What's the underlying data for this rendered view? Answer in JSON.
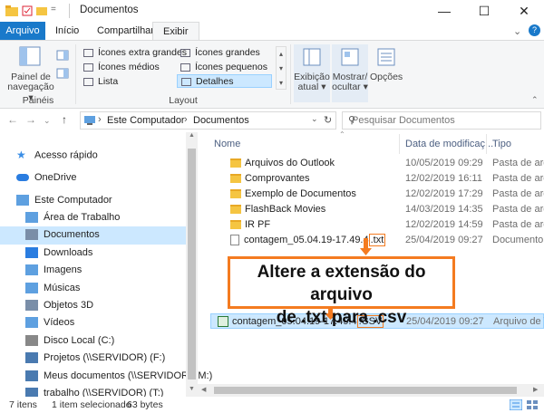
{
  "window": {
    "title": "Documentos",
    "minimize": "—",
    "maximize": "☐",
    "close": "✕",
    "qa_sep": "="
  },
  "tabs": [
    "Arquivo",
    "Início",
    "Compartilhar",
    "Exibir"
  ],
  "ribbon": {
    "panes": {
      "label_line1": "Painel de",
      "label_line2": "navegação ▾",
      "group": "Painéis"
    },
    "layout": {
      "items_col1": [
        "Ícones extra grandes",
        "Ícones médios",
        "Lista"
      ],
      "items_col2": [
        "Ícones grandes",
        "Ícones pequenos",
        "Detalhes"
      ],
      "group": "Layout"
    },
    "current_view": {
      "line1": "Exibição",
      "line2": "atual ▾"
    },
    "show_hide": {
      "line1": "Mostrar/",
      "line2": "ocultar ▾"
    },
    "options": "Opções"
  },
  "address": {
    "path1": "Este Computador",
    "path2": "Documentos",
    "search_placeholder": "Pesquisar Documentos"
  },
  "nav": {
    "items": [
      {
        "label": "Acesso rápido",
        "icon": "star-icon"
      },
      {
        "label": "OneDrive",
        "icon": "cloud-icon"
      },
      {
        "label": "Este Computador",
        "icon": "computer-icon"
      },
      {
        "label": "Área de Trabalho",
        "icon": "desktop-icon"
      },
      {
        "label": "Documentos",
        "icon": "documents-icon"
      },
      {
        "label": "Downloads",
        "icon": "download-icon"
      },
      {
        "label": "Imagens",
        "icon": "images-icon"
      },
      {
        "label": "Músicas",
        "icon": "music-icon"
      },
      {
        "label": "Objetos 3D",
        "icon": "cube-icon"
      },
      {
        "label": "Vídeos",
        "icon": "video-icon"
      },
      {
        "label": "Disco Local (C:)",
        "icon": "drive-icon"
      },
      {
        "label": "Projetos (\\\\SERVIDOR) (F:)",
        "icon": "network-drive-icon"
      },
      {
        "label": "Meus documentos (\\\\SERVIDOR) (M:)",
        "icon": "network-drive-icon"
      },
      {
        "label": "trabalho (\\\\SERVIDOR) (T:)",
        "icon": "network-drive-icon"
      }
    ]
  },
  "columns": {
    "name": "Nome",
    "date": "Data de modificaç...",
    "type": "Tipo"
  },
  "files": [
    {
      "name": "Arquivos do Outlook",
      "date": "10/05/2019 09:29",
      "type": "Pasta de arqu"
    },
    {
      "name": "Comprovantes",
      "date": "12/02/2019 16:11",
      "type": "Pasta de arqu"
    },
    {
      "name": "Exemplo de Documentos",
      "date": "12/02/2019 17:29",
      "type": "Pasta de arqu"
    },
    {
      "name": "FlashBack Movies",
      "date": "14/03/2019 14:35",
      "type": "Pasta de arqu"
    },
    {
      "name": "IR PF",
      "date": "12/02/2019 14:59",
      "type": "Pasta de arqu"
    }
  ],
  "txt_file": {
    "name_base": "contagem_05.04.19-17.49.4",
    "ext": ".txt",
    "date": "25/04/2019 09:27",
    "type": "Documento de"
  },
  "csv_file": {
    "name_base": "contagem_05.04.19-17.49.4",
    "ext": ".CSV",
    "date": "25/04/2019 09:27",
    "type": "Arquivo de V"
  },
  "callout": {
    "line1": "Altere a extensão do arquivo",
    "line2": "de .txt para .csv"
  },
  "status": {
    "count": "7 itens",
    "selected": "1 item selecionado",
    "size": "63 bytes"
  },
  "colors": {
    "accent": "#1979ca",
    "selection": "#cce8ff",
    "highlight": "#f47b20"
  }
}
